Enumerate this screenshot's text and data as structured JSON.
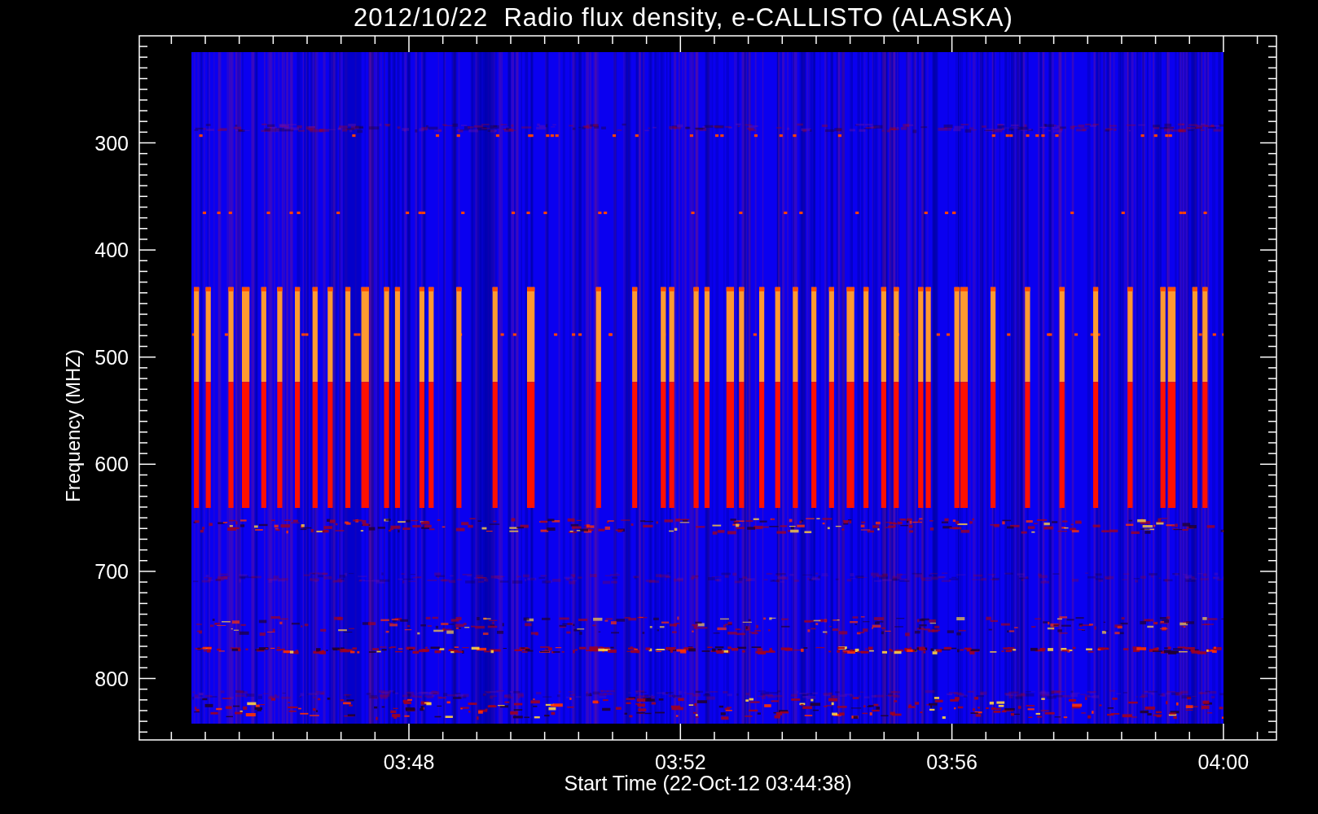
{
  "title": "2012/10/22  Radio flux density, e-CALLISTO (ALASKA)",
  "y_axis": {
    "label": "Frequency (MHZ)",
    "ticks": [
      "300",
      "400",
      "500",
      "600",
      "700",
      "800"
    ]
  },
  "x_axis": {
    "label": "Start Time (22-Oct-12 03:44:38)",
    "ticks": [
      "03:48",
      "03:52",
      "03:56",
      "04:00"
    ]
  }
}
